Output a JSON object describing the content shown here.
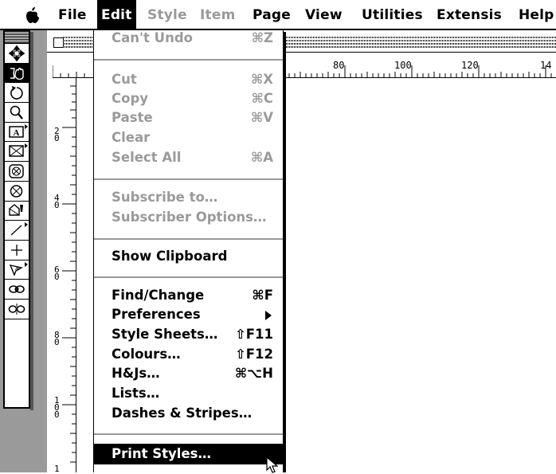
{
  "menubar": {
    "items": [
      {
        "label": "File",
        "state": "normal"
      },
      {
        "label": "Edit",
        "state": "active"
      },
      {
        "label": "Style",
        "state": "disabled"
      },
      {
        "label": "Item",
        "state": "disabled"
      },
      {
        "label": "Page",
        "state": "normal"
      },
      {
        "label": "View",
        "state": "normal"
      },
      {
        "label": "Utilities",
        "state": "normal"
      },
      {
        "label": "Extensis",
        "state": "normal"
      },
      {
        "label": "Help",
        "state": "normal"
      }
    ]
  },
  "ruler": {
    "h_labels": [
      "80",
      "100",
      "120",
      "14"
    ],
    "v_labels": [
      "2\n0",
      "4\n0",
      "6\n0",
      "8\n0",
      "1\n0\n0",
      "1"
    ]
  },
  "tools": [
    "item-tool",
    "content-tool",
    "rotation-tool",
    "zoom-tool",
    "text-box-tool",
    "picture-box-tool",
    "oval-picture-tool",
    "bezier-picture-tool",
    "freehand-picture-tool",
    "line-tool",
    "orthogonal-line-tool",
    "text-path-tool",
    "linking-tool",
    "unlinking-tool"
  ],
  "edit_menu": {
    "undo": {
      "label": "Can't Undo",
      "shortcut": "⌘Z"
    },
    "cut": {
      "label": "Cut",
      "shortcut": "⌘X"
    },
    "copy": {
      "label": "Copy",
      "shortcut": "⌘C"
    },
    "paste": {
      "label": "Paste",
      "shortcut": "⌘V"
    },
    "clear": {
      "label": "Clear",
      "shortcut": ""
    },
    "select_all": {
      "label": "Select All",
      "shortcut": "⌘A"
    },
    "subscribe_to": {
      "label": "Subscribe to…",
      "shortcut": ""
    },
    "subscriber_options": {
      "label": "Subscriber Options…",
      "shortcut": ""
    },
    "show_clipboard": {
      "label": "Show Clipboard",
      "shortcut": ""
    },
    "find_change": {
      "label": "Find/Change",
      "shortcut": "⌘F"
    },
    "preferences": {
      "label": "Preferences",
      "shortcut": ""
    },
    "style_sheets": {
      "label": "Style Sheets…",
      "shortcut": "⇧F11"
    },
    "colours": {
      "label": "Colours…",
      "shortcut": "⇧F12"
    },
    "hjs": {
      "label": "H&Js…",
      "shortcut": "⌘⌥H"
    },
    "lists": {
      "label": "Lists…",
      "shortcut": ""
    },
    "dashes_stripes": {
      "label": "Dashes & Stripes…",
      "shortcut": ""
    },
    "print_styles": {
      "label": "Print Styles…",
      "shortcut": ""
    }
  },
  "colors": {
    "menu_disabled": "#9a9a9a",
    "highlight": "#000000",
    "window_gray": "#9a9a9a"
  }
}
